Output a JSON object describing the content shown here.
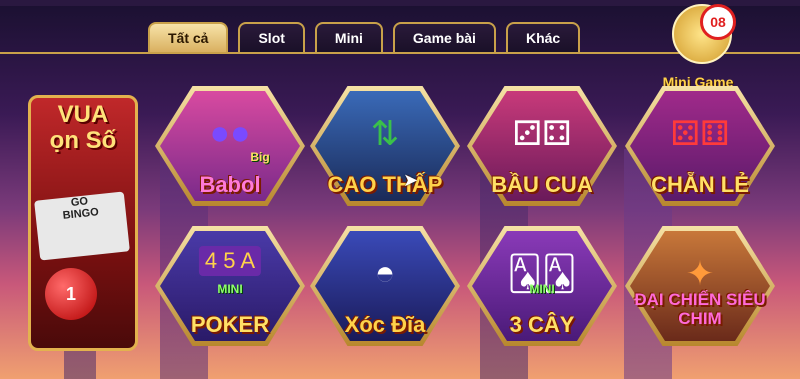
{
  "tabs": [
    {
      "label": "Tất cả",
      "active": true
    },
    {
      "label": "Slot",
      "active": false
    },
    {
      "label": "Mini",
      "active": false
    },
    {
      "label": "Game bài",
      "active": false
    },
    {
      "label": "Khác",
      "active": false
    }
  ],
  "banner": {
    "title_line1": "VUA",
    "title_line2": "ọn Số",
    "bingo_1": "GO",
    "bingo_2": "BINGO",
    "ball_number": "1"
  },
  "mini_game": {
    "label": "Mini Game",
    "count": "08"
  },
  "games": [
    {
      "name": "Babol",
      "badge": "Big",
      "sub": ""
    },
    {
      "name": "CAO THẤP",
      "sub": ""
    },
    {
      "name": "BẦU CUA",
      "sub": ""
    },
    {
      "name": "CHẴN LẺ",
      "sub": ""
    },
    {
      "name": "POKER",
      "sub": "MINI",
      "reel": "4 5 A"
    },
    {
      "name": "Xóc Đĩa",
      "sub": ""
    },
    {
      "name": "3 CÂY",
      "sub": "MINI"
    },
    {
      "name": "ĐẠI CHIẾN SIÊU CHIM",
      "sub": ""
    }
  ],
  "colors": {
    "accent_gold": "#c9a14a",
    "tab_active_bg": "#e8c77a",
    "title_yellow": "#ffe066",
    "badge_red": "#e02020"
  }
}
